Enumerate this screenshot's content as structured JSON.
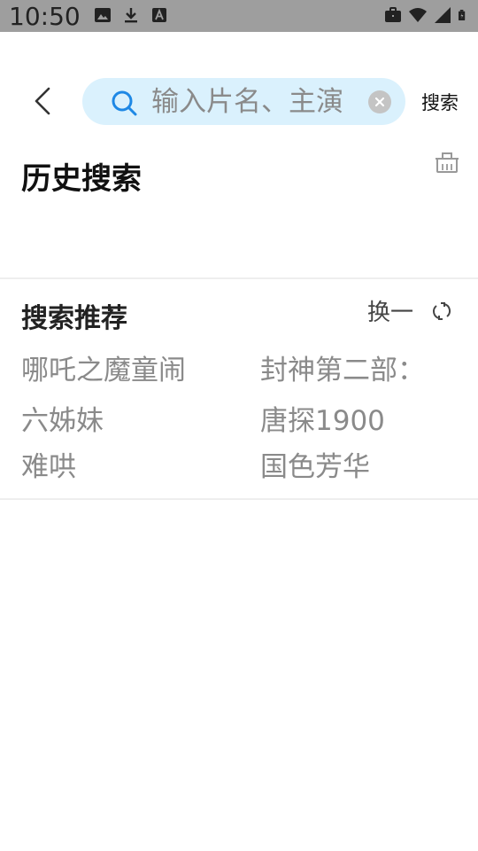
{
  "status_bar": {
    "time": "10:50",
    "left_icons": [
      "image-icon",
      "download-icon",
      "font-icon"
    ],
    "right_icons": [
      "briefcase-icon",
      "wifi-icon",
      "signal-icon",
      "battery-icon"
    ]
  },
  "search": {
    "placeholder": "输入片名、主演",
    "value": "",
    "submit_label": "搜索"
  },
  "history": {
    "title": "历史搜索",
    "items": []
  },
  "recommendations": {
    "title": "搜索推荐",
    "refresh_label": "换一",
    "items": [
      {
        "label": "哪吒之魔童闹"
      },
      {
        "label": "封神第二部："
      },
      {
        "label": "六姊妹"
      },
      {
        "label": "唐探1900"
      },
      {
        "label": "难哄"
      },
      {
        "label": "国色芳华"
      }
    ]
  },
  "colors": {
    "status_bar_bg": "#9e9e9e",
    "search_bg": "#daf1fd",
    "accent": "#1e88e5",
    "muted_text": "#8a8a8a"
  }
}
